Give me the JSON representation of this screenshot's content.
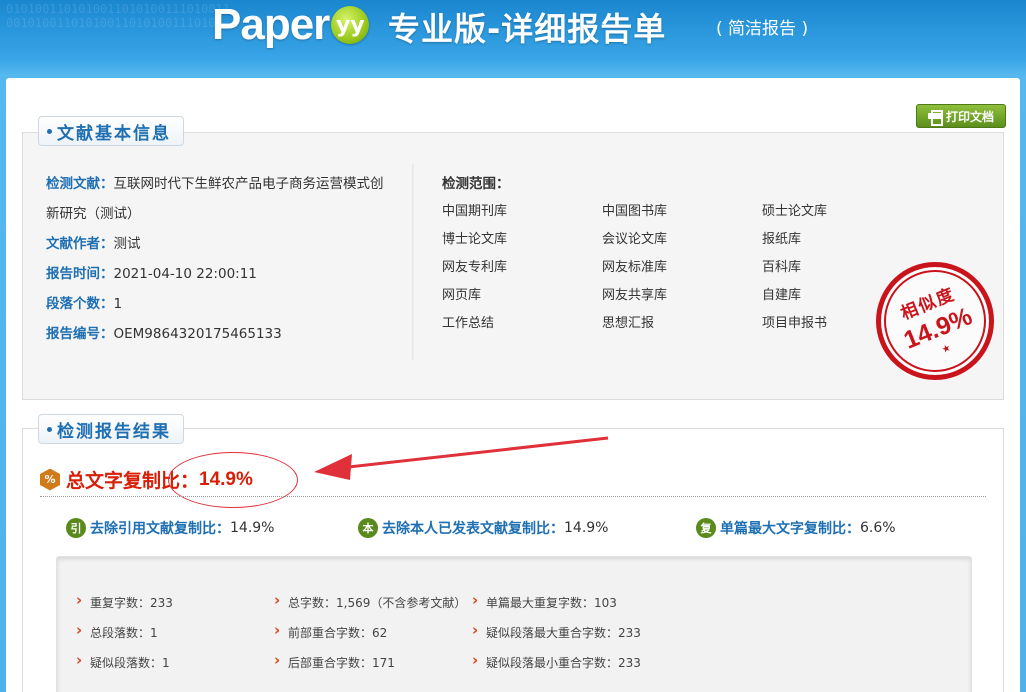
{
  "header": {
    "logo_text": "Paper",
    "logo_mark": "yy",
    "title": "专业版-详细报告单",
    "subtitle": "( 简洁报告 )",
    "deco_digits": "010100110101001101010011101001100101001101010011010100111010"
  },
  "toolbar": {
    "print_label": "打印文档"
  },
  "basic_info": {
    "section_title": "文献基本信息",
    "doc_label": "检测文献：",
    "doc_value_line1": "互联网时代下生鲜农产品电子商务运营模式创",
    "doc_value_line2": "新研究（测试）",
    "author_label": "文献作者：",
    "author_value": "测试",
    "time_label": "报告时间：",
    "time_value": "2021-04-10 22:00:11",
    "para_label": "段落个数：",
    "para_value": "1",
    "report_no_label": "报告编号：",
    "report_no_value": "OEM9864320175465133",
    "scope_label": "检测范围：",
    "databases": [
      [
        "中国期刊库",
        "中国图书库",
        "硕士论文库"
      ],
      [
        "博士论文库",
        "会议论文库",
        "报纸库"
      ],
      [
        "网友专利库",
        "网友标准库",
        "百科库"
      ],
      [
        "网页库",
        "网友共享库",
        "自建库"
      ],
      [
        "工作总结",
        "思想汇报",
        "项目申报书"
      ]
    ]
  },
  "stamp": {
    "label": "相似度",
    "value": "14.9%",
    "star": "★"
  },
  "results": {
    "section_title": "检测报告结果",
    "total_icon": "%",
    "total_label": "总文字复制比：",
    "total_value": "14.9%",
    "sub": [
      {
        "icon": "引",
        "label": "去除引用文献复制比：",
        "value": "14.9%"
      },
      {
        "icon": "本",
        "label": "去除本人已发表文献复制比：",
        "value": "14.9%"
      },
      {
        "icon": "复",
        "label": "单篇最大文字复制比：",
        "value": "6.6%"
      }
    ],
    "stats": [
      [
        "重复字数：233",
        "总字数：1,569（不含参考文献）",
        "单篇最大重复字数：103"
      ],
      [
        "总段落数：1",
        "前部重合字数：62",
        "疑似段落最大重合字数：233"
      ],
      [
        "疑似段落数：1",
        "后部重合字数：171",
        "疑似段落最小重合字数：233"
      ]
    ]
  },
  "colors": {
    "accent_blue": "#1f6fb3",
    "alert_red": "#d81e06",
    "button_green": "#6f9f25",
    "stamp_red": "#c9141c"
  }
}
